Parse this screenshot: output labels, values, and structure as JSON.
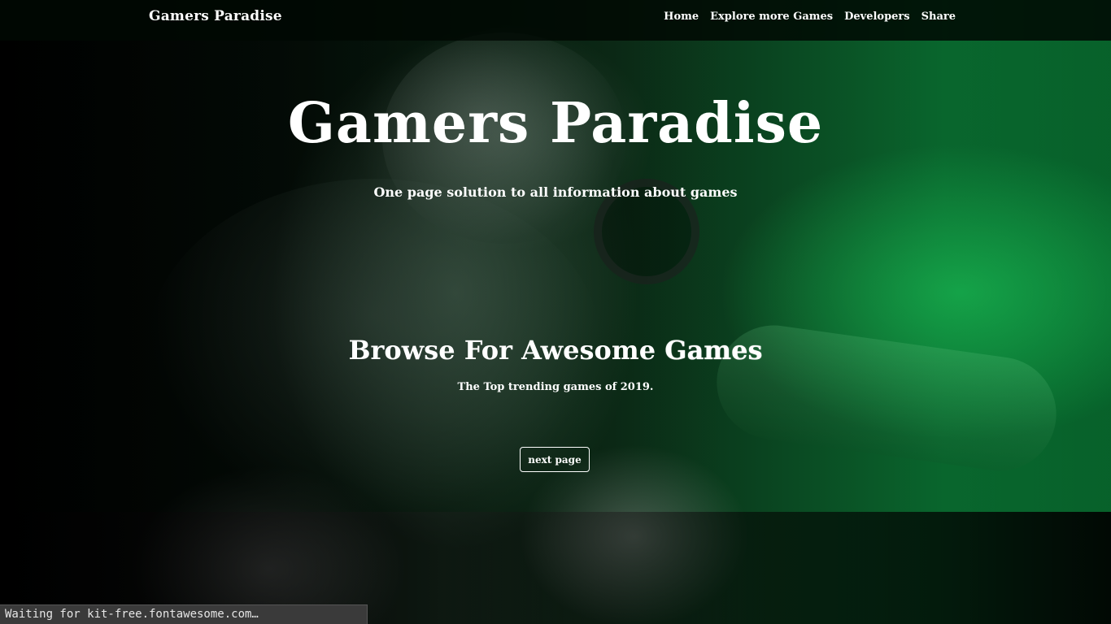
{
  "navbar": {
    "brand": "Gamers Paradise",
    "links": [
      "Home",
      "Explore more Games",
      "Developers",
      "Share"
    ]
  },
  "hero": {
    "title": "Gamers Paradise",
    "subtitle": "One page solution to all information about games"
  },
  "section": {
    "title_prefix": "Browse For Awesome ",
    "title_emphasis": "Games",
    "subtitle": "The Top trending games of 2019.",
    "button_label": "next page"
  },
  "status_bar": {
    "text": "Waiting for kit-free.fontawesome.com…"
  },
  "colors": {
    "accent_green": "#0c8a3a",
    "text": "#ffffff",
    "navbar_bg": "#000802"
  }
}
